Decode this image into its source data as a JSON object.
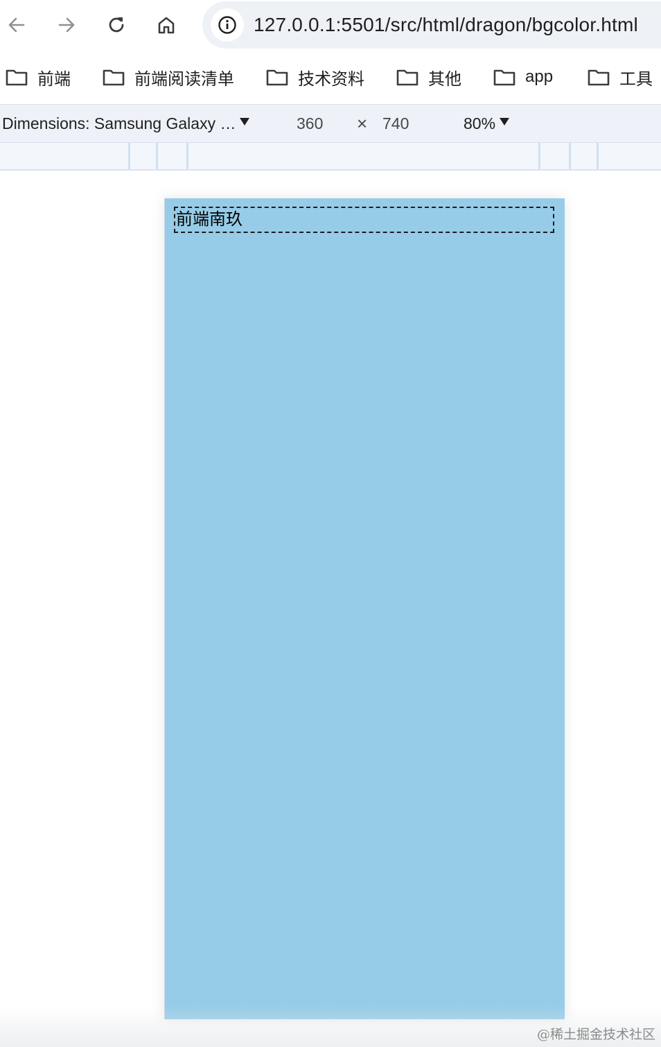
{
  "browser": {
    "url": "127.0.0.1:5501/src/html/dragon/bgcolor.html"
  },
  "bookmarks": [
    {
      "label": "前端",
      "icon": "folder-icon"
    },
    {
      "label": "前端阅读清单",
      "icon": "folder-icon"
    },
    {
      "label": "技术资料",
      "icon": "folder-icon"
    },
    {
      "label": "其他",
      "icon": "folder-icon"
    },
    {
      "label": "app",
      "icon": "folder-icon"
    },
    {
      "label": "工具",
      "icon": "folder-icon"
    }
  ],
  "device_toolbar": {
    "dimensions_label": "Dimensions: Samsung Galaxy …",
    "width": "360",
    "separator": "×",
    "height": "740",
    "zoom": "80%"
  },
  "page": {
    "background_color": "#97cce8",
    "box_text": "前端南玖"
  },
  "watermark": "@稀土掘金技术社区"
}
